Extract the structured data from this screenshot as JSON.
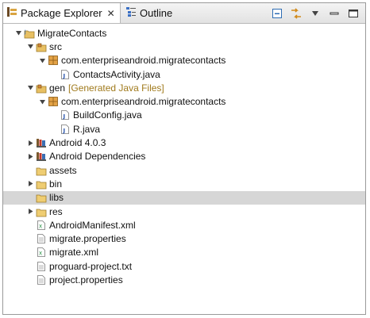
{
  "tabs": [
    {
      "label": "Package Explorer",
      "close": "✕",
      "active": true
    },
    {
      "label": "Outline",
      "active": false
    }
  ],
  "tree": [
    {
      "label": "MigrateContacts",
      "depth": 0,
      "expanded": true,
      "icon": "project-icon"
    },
    {
      "label": "src",
      "depth": 1,
      "expanded": true,
      "icon": "source-folder-icon"
    },
    {
      "label": "com.enterpriseandroid.migratecontacts",
      "depth": 2,
      "expanded": true,
      "icon": "package-icon"
    },
    {
      "label": "ContactsActivity.java",
      "depth": 3,
      "icon": "java-file-icon"
    },
    {
      "label": "gen",
      "decoration": "[Generated Java Files]",
      "depth": 1,
      "expanded": true,
      "icon": "source-folder-icon"
    },
    {
      "label": "com.enterpriseandroid.migratecontacts",
      "depth": 2,
      "expanded": true,
      "icon": "package-icon"
    },
    {
      "label": "BuildConfig.java",
      "depth": 3,
      "icon": "java-file-icon"
    },
    {
      "label": "R.java",
      "depth": 3,
      "icon": "java-file-icon"
    },
    {
      "label": "Android 4.0.3",
      "depth": 1,
      "expanded": false,
      "icon": "library-icon"
    },
    {
      "label": "Android Dependencies",
      "depth": 1,
      "expanded": false,
      "icon": "library-icon"
    },
    {
      "label": "assets",
      "depth": 1,
      "icon": "folder-icon"
    },
    {
      "label": "bin",
      "depth": 1,
      "expanded": false,
      "icon": "folder-icon"
    },
    {
      "label": "libs",
      "depth": 1,
      "icon": "folder-icon",
      "selected": true
    },
    {
      "label": "res",
      "depth": 1,
      "expanded": false,
      "icon": "folder-icon"
    },
    {
      "label": "AndroidManifest.xml",
      "depth": 1,
      "icon": "xml-file-icon"
    },
    {
      "label": "migrate.properties",
      "depth": 1,
      "icon": "text-file-icon"
    },
    {
      "label": "migrate.xml",
      "depth": 1,
      "icon": "xml-file-icon"
    },
    {
      "label": "proguard-project.txt",
      "depth": 1,
      "icon": "text-file-icon"
    },
    {
      "label": "project.properties",
      "depth": 1,
      "icon": "text-file-icon"
    }
  ],
  "colors": {
    "selection": "#d6d6d6",
    "decoration": "#a07a1c",
    "folder": "#e8c063",
    "package": "#c58a2c",
    "java": "#3a5fb0"
  }
}
